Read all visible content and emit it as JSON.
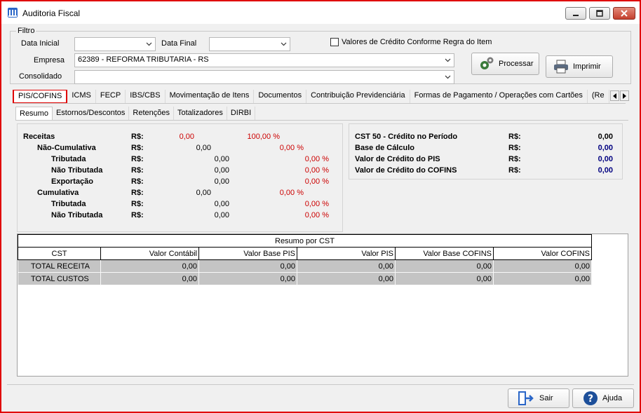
{
  "window": {
    "title": "Auditoria Fiscal"
  },
  "filtro": {
    "legend": "Filtro",
    "data_inicial_label": "Data Inicial",
    "data_inicial_value": "",
    "data_final_label": "Data Final",
    "data_final_value": "",
    "valores_credito_label": "Valores de Crédito Conforme Regra do Item",
    "valores_credito_checked": false,
    "empresa_label": "Empresa",
    "empresa_value": "62389 - REFORMA TRIBUTARIA - RS",
    "consolidado_label": "Consolidado",
    "consolidado_value": "",
    "processar_label": "Processar",
    "imprimir_label": "Imprimir"
  },
  "tabs": [
    "PIS/COFINS",
    "ICMS",
    "FECP",
    "IBS/CBS",
    "Movimentação de Itens",
    "Documentos",
    "Contribuição Previdenciária",
    "Formas de Pagamento / Operações com Cartões",
    "(Re"
  ],
  "subtabs": [
    "Resumo",
    "Estornos/Descontos",
    "Retenções",
    "Totalizadores",
    "DIRBI"
  ],
  "resumo_left": [
    {
      "label": "Receitas",
      "cur": "R$:",
      "value": "0,00",
      "pct": "100,00 %"
    },
    {
      "label": "Não-Cumulativa",
      "cur": "R$:",
      "value": "0,00",
      "pct": "0,00 %"
    },
    {
      "label": "Tributada",
      "cur": "R$:",
      "value": "0,00",
      "pct": "0,00 %"
    },
    {
      "label": "Não Tributada",
      "cur": "R$:",
      "value": "0,00",
      "pct": "0,00 %"
    },
    {
      "label": "Exportação",
      "cur": "R$:",
      "value": "0,00",
      "pct": "0,00 %"
    },
    {
      "label": "Cumulativa",
      "cur": "R$:",
      "value": "0,00",
      "pct": "0,00 %"
    },
    {
      "label": "Tributada",
      "cur": "R$:",
      "value": "0,00",
      "pct": "0,00 %"
    },
    {
      "label": "Não Tributada",
      "cur": "R$:",
      "value": "0,00",
      "pct": "0,00 %"
    }
  ],
  "resumo_right": [
    {
      "label": "CST 50 - Crédito no Período",
      "cur": "R$:",
      "value": "0,00"
    },
    {
      "label": "Base de Cálculo",
      "cur": "R$:",
      "value": "0,00"
    },
    {
      "label": "Valor de Crédito do PIS",
      "cur": "R$:",
      "value": "0,00"
    },
    {
      "label": "Valor de Crédito do COFINS",
      "cur": "R$:",
      "value": "0,00"
    }
  ],
  "grid": {
    "caption": "Resumo por CST",
    "headers": [
      "CST",
      "Valor Contábil",
      "Valor Base PIS",
      "Valor PIS",
      "Valor Base COFINS",
      "Valor COFINS"
    ],
    "rows": [
      [
        "TOTAL RECEITA",
        "0,00",
        "0,00",
        "0,00",
        "0,00",
        "0,00"
      ],
      [
        "TOTAL CUSTOS",
        "0,00",
        "0,00",
        "0,00",
        "0,00",
        "0,00"
      ]
    ]
  },
  "footer": {
    "sair_label": "Sair",
    "ajuda_label": "Ajuda"
  },
  "colors": {
    "highlight_border": "#e00000",
    "percent_red": "#cc0000",
    "credit_value_navy": "#000080"
  }
}
